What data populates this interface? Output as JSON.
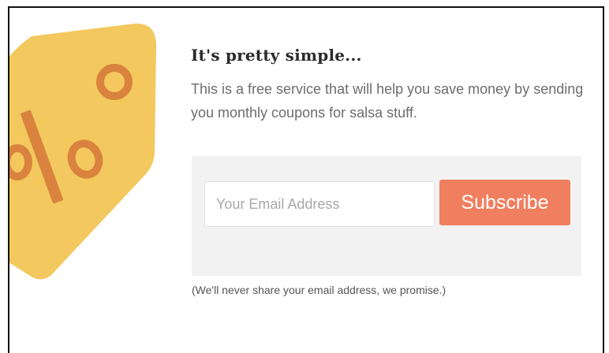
{
  "colors": {
    "tag_fill": "#f3c85e",
    "tag_accent": "#d9833e",
    "button_bg": "#f07f5f",
    "panel_bg": "#f2f2f2",
    "heading_text": "#2b2b2b",
    "body_text": "#6d6d6d"
  },
  "illustration": {
    "icon": "percent-price-tag-icon"
  },
  "content": {
    "heading": "It's pretty simple...",
    "description": "This is a free service that will help you save money by sending you monthly coupons for salsa stuff."
  },
  "form": {
    "email_placeholder": "Your Email Address",
    "email_value": "",
    "subscribe_label": "Subscribe"
  },
  "footer": {
    "privacy_note": "(We'll never share your email address, we promise.)"
  }
}
